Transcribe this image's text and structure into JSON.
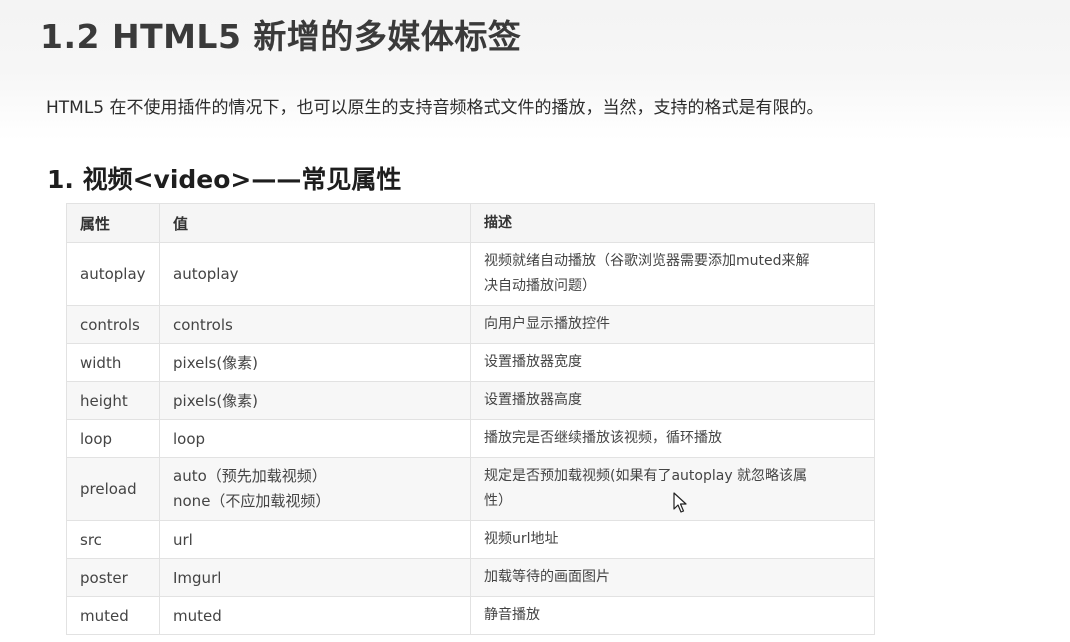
{
  "title": "1.2 HTML5 新增的多媒体标签",
  "intro": "HTML5 在不使用插件的情况下，也可以原生的支持音频格式文件的播放，当然，支持的格式是有限的。",
  "section_heading": "1. 视频<video>——常见属性",
  "table": {
    "headers": [
      "属性",
      "值",
      "描述"
    ],
    "rows": [
      {
        "attr": "autoplay",
        "value": "autoplay",
        "value2": "",
        "desc": "视频就绪自动播放（谷歌浏览器需要添加muted来解",
        "desc2": "决自动播放问题）"
      },
      {
        "attr": "controls",
        "value": "controls",
        "value2": "",
        "desc": "向用户显示播放控件",
        "desc2": ""
      },
      {
        "attr": "width",
        "value": "pixels(像素)",
        "value2": "",
        "desc": "设置播放器宽度",
        "desc2": ""
      },
      {
        "attr": "height",
        "value": "pixels(像素)",
        "value2": "",
        "desc": "设置播放器高度",
        "desc2": ""
      },
      {
        "attr": "loop",
        "value": "loop",
        "value2": "",
        "desc": "播放完是否继续播放该视频，循环播放",
        "desc2": ""
      },
      {
        "attr": "preload",
        "value": "auto（预先加载视频）",
        "value2": "none（不应加载视频）",
        "desc": "规定是否预加载视频(如果有了autoplay   就忽略该属",
        "desc2": "性）"
      },
      {
        "attr": "src",
        "value": "url",
        "value2": "",
        "desc": "视频url地址",
        "desc2": ""
      },
      {
        "attr": "poster",
        "value": "Imgurl",
        "value2": "",
        "desc": "加载等待的画面图片",
        "desc2": ""
      },
      {
        "attr": "muted",
        "value": "muted",
        "value2": "",
        "desc": "静音播放",
        "desc2": ""
      }
    ]
  }
}
